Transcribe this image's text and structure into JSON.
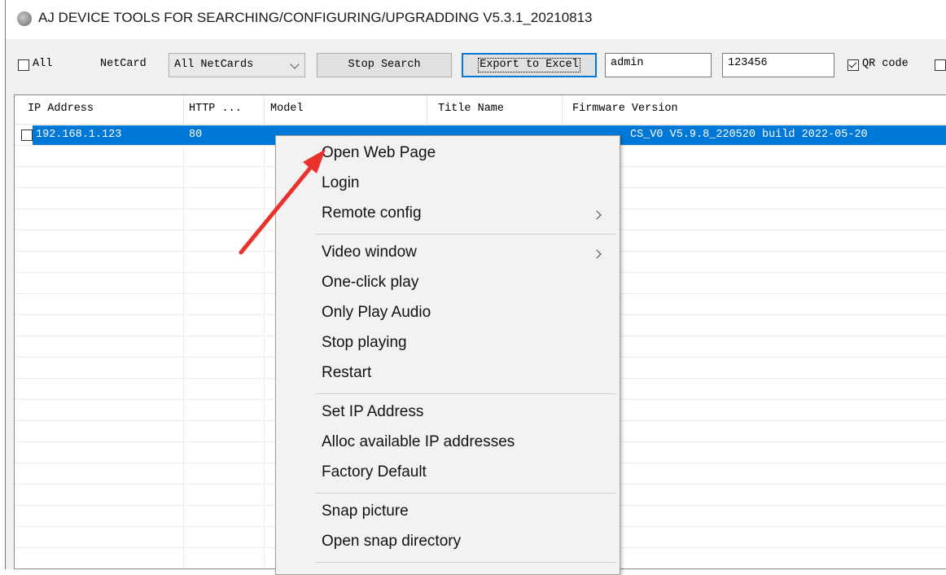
{
  "window": {
    "title": "AJ DEVICE TOOLS FOR SEARCHING/CONFIGURING/UPGRADDING V5.3.1_20210813"
  },
  "toolbar": {
    "all_label": "All",
    "netcard_label": "NetCard",
    "netcard_value": "All NetCards",
    "stop_search_label": "Stop Search",
    "export_label": "Export to Excel",
    "username_value": "admin",
    "password_value": "123456",
    "qr_label": "QR code",
    "qr_checked": true
  },
  "table": {
    "columns": [
      "IP Address",
      "HTTP ...",
      "Model",
      "Title Name",
      "Firmware Version"
    ],
    "rows": [
      {
        "ip": "192.168.1.123",
        "http": "80",
        "model": "",
        "title": "",
        "firmware": "CS_V0 V5.9.8_220520 build 2022-05-20",
        "selected": true
      }
    ]
  },
  "context_menu": {
    "items": [
      {
        "label": "Open Web Page"
      },
      {
        "label": "Login"
      },
      {
        "label": "Remote config",
        "submenu": true
      },
      {
        "label": "Video window",
        "submenu": true
      },
      {
        "label": "One-click play"
      },
      {
        "label": "Only Play Audio"
      },
      {
        "label": "Stop playing"
      },
      {
        "label": "Restart"
      },
      {
        "label": "Set IP Address"
      },
      {
        "label": "Alloc available IP addresses"
      },
      {
        "label": "Factory Default"
      },
      {
        "label": "Snap picture"
      },
      {
        "label": "Open snap directory"
      }
    ]
  },
  "annotation": {
    "color": "#e8322b",
    "points_to": "Open Web Page"
  },
  "colors": {
    "selection": "#0078d7",
    "focus_border": "#0078d7"
  }
}
